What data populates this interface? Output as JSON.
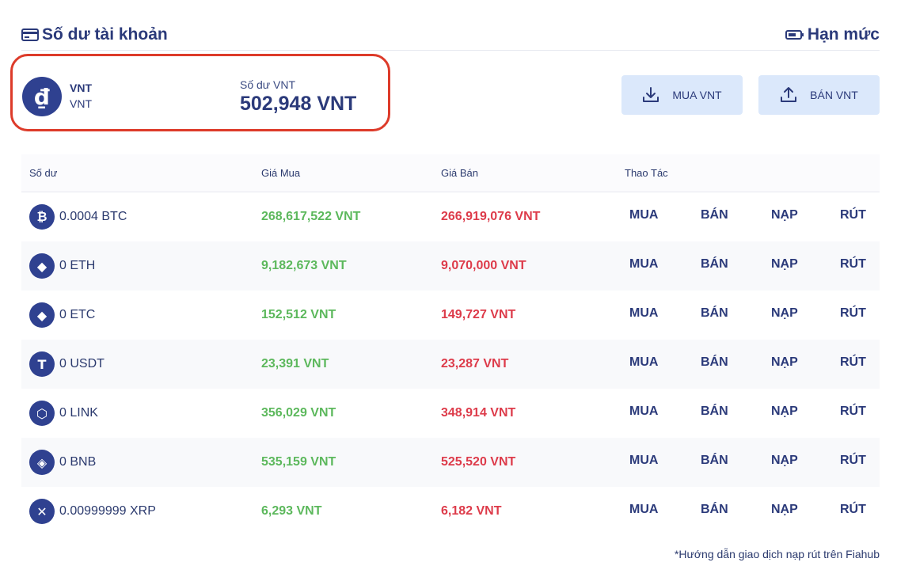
{
  "header": {
    "title": "Số dư tài khoản",
    "title_icon": "wallet-icon",
    "limit_label": "Hạn mức",
    "limit_icon": "battery-icon"
  },
  "balance": {
    "currency_symbol": "₫",
    "currency_name": "VNT",
    "currency_sub": "VNT",
    "label": "Số dư VNT",
    "value": "502,948 VNT",
    "highlight_color": "#dd3b2a"
  },
  "actions": {
    "buy_label": "MUA VNT",
    "buy_icon": "download-icon",
    "sell_label": "BÁN VNT",
    "sell_icon": "upload-icon"
  },
  "table": {
    "headers": [
      "Số dư",
      "Giá Mua",
      "Giá Bán",
      "Thao Tác"
    ],
    "rows": [
      {
        "icon": "bitcoin-icon",
        "glyph": "₿",
        "amount": "0.0004 BTC",
        "buy": "268,617,522 VNT",
        "sell": "266,919,076 VNT"
      },
      {
        "icon": "ethereum-icon",
        "glyph": "◆",
        "amount": "0 ETH",
        "buy": "9,182,673 VNT",
        "sell": "9,070,000 VNT"
      },
      {
        "icon": "ethereum-classic-icon",
        "glyph": "◆",
        "amount": "0 ETC",
        "buy": "152,512 VNT",
        "sell": "149,727 VNT"
      },
      {
        "icon": "tether-icon",
        "glyph": "T",
        "amount": "0 USDT",
        "buy": "23,391 VNT",
        "sell": "23,287 VNT"
      },
      {
        "icon": "chainlink-icon",
        "glyph": "⬡",
        "amount": "0 LINK",
        "buy": "356,029 VNT",
        "sell": "348,914 VNT"
      },
      {
        "icon": "binance-icon",
        "glyph": "◈",
        "amount": "0 BNB",
        "buy": "535,159 VNT",
        "sell": "525,520 VNT"
      },
      {
        "icon": "ripple-icon",
        "glyph": "✕",
        "amount": "0.00999999 XRP",
        "buy": "6,293 VNT",
        "sell": "6,182 VNT"
      }
    ],
    "ops": {
      "buy": "MUA",
      "sell": "BÁN",
      "deposit": "NẠP",
      "withdraw": "RÚT"
    }
  },
  "colors": {
    "primary": "#2b3a7a",
    "buy_price": "#5cb85c",
    "sell_price": "#dd3b4a",
    "button_bg": "#dbe8fb"
  },
  "footnote": "*Hướng dẫn giao dịch nạp rút trên Fiahub"
}
